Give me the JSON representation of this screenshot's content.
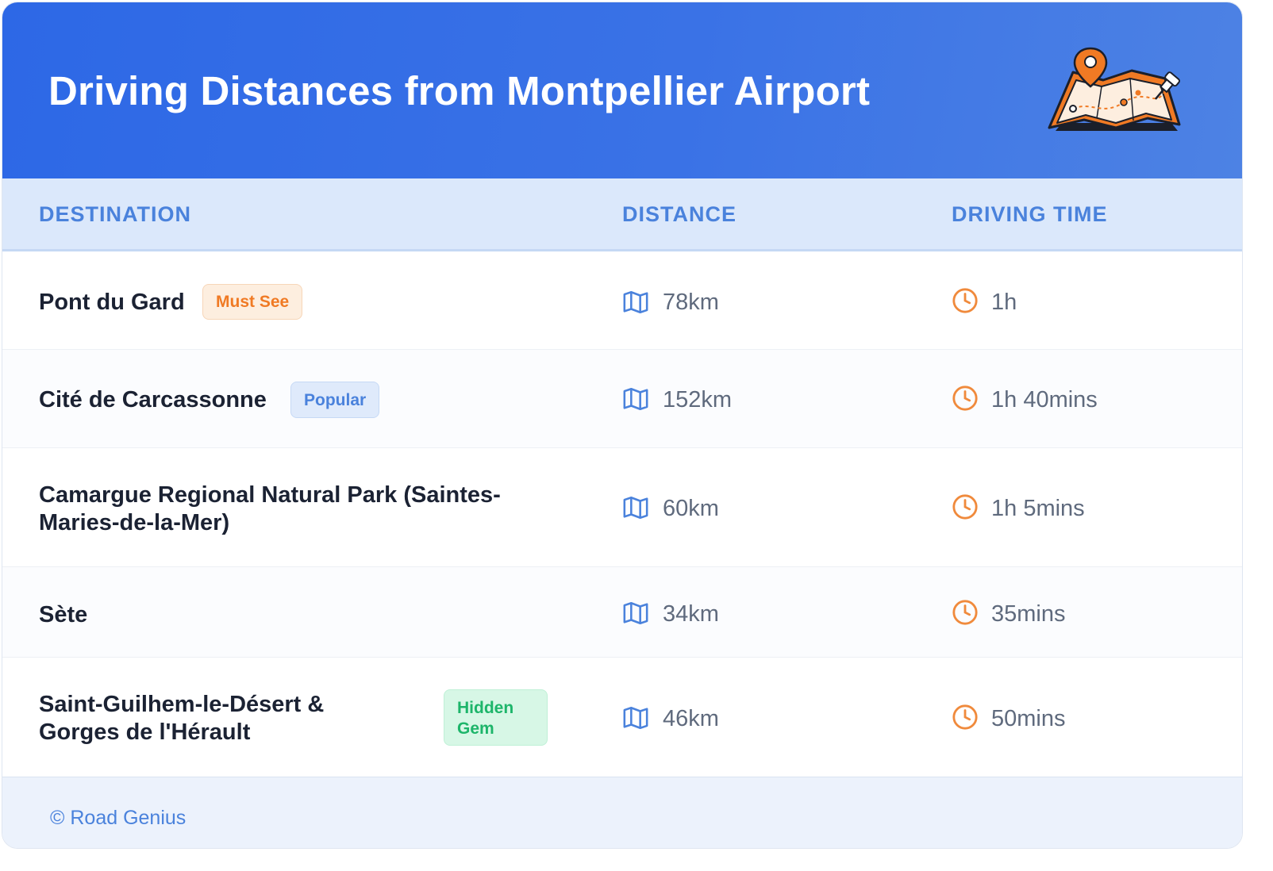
{
  "header": {
    "title": "Driving Distances from Montpellier Airport",
    "illustration_icon": "folded-map-with-pins-icon"
  },
  "table": {
    "columns": [
      "DESTINATION",
      "DISTANCE",
      "DRIVING TIME"
    ],
    "rows": [
      {
        "destination": "Pont du Gard",
        "badge": "Must See",
        "distance": "78km",
        "time": "1h"
      },
      {
        "destination": "Cité de Carcassonne",
        "badge": "Popular",
        "distance": "152km",
        "time": "1h 40mins"
      },
      {
        "destination_line1": "Camargue Regional Natural Park (Saintes-",
        "destination_line2": "Maries-de-la-Mer)",
        "distance": "60km",
        "time": "1h 5mins"
      },
      {
        "destination": "Sète",
        "distance": "34km",
        "time": "35mins"
      },
      {
        "destination_line1": "Saint-Guilhem-le-Désert &",
        "destination_line2": "Gorges de l'Hérault",
        "badge_line1": "Hidden",
        "badge_line2": "Gem",
        "distance": "46km",
        "time": "50mins"
      }
    ]
  },
  "footer": {
    "text": "© Road Genius"
  },
  "colors": {
    "header_bg": "#2d68e6",
    "accent_blue": "#4a82dc",
    "accent_orange": "#f07a24",
    "badge_green": "#1db56a"
  }
}
